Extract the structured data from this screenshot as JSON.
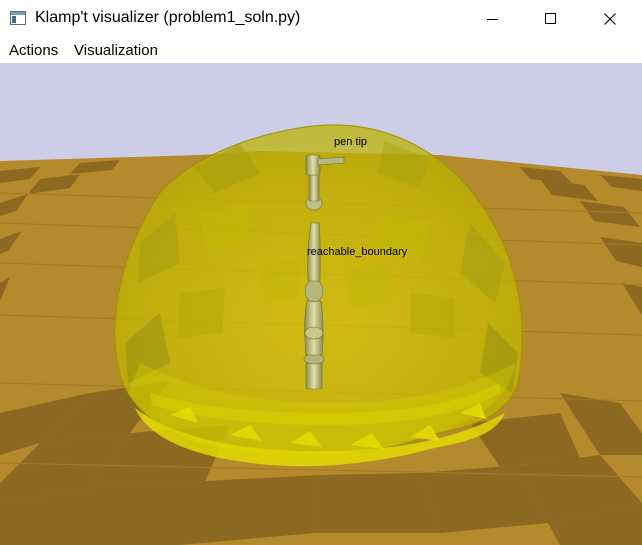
{
  "window": {
    "title": "Klamp't visualizer (problem1_soln.py)",
    "icon": "app-window-icon",
    "controls": [
      "minimize-icon",
      "maximize-icon",
      "close-icon"
    ]
  },
  "menu": {
    "items": [
      "Actions",
      "Visualization"
    ]
  },
  "scene": {
    "background_color": "#cdcde8",
    "floor_colors": [
      "#b58a2c",
      "#8c6920"
    ],
    "hull_color": "#e0e000",
    "robot_color": "#c8c889",
    "labels": {
      "pen_tip": "pen tip",
      "reachable_boundary": "reachable_boundary"
    }
  }
}
